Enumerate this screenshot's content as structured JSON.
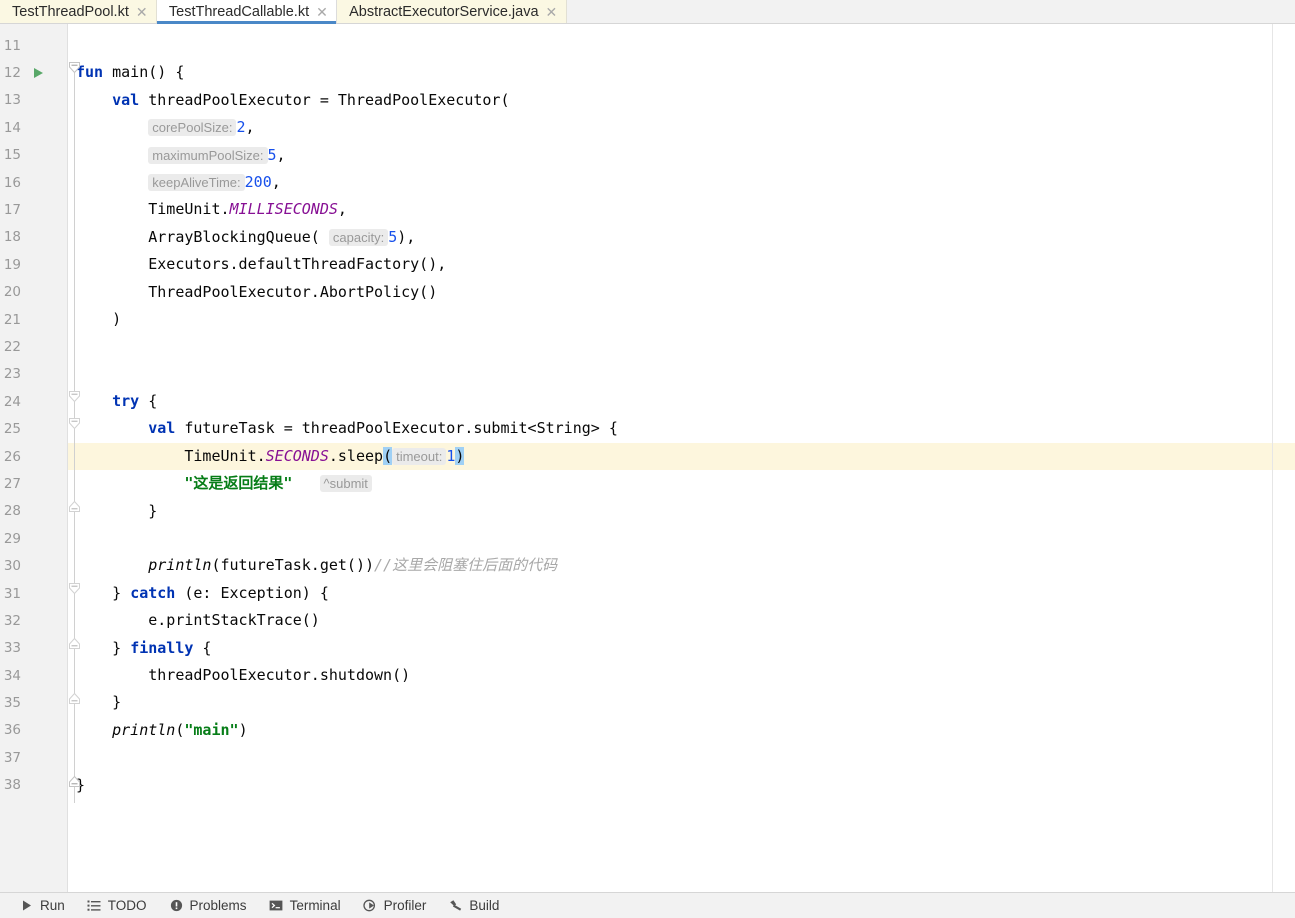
{
  "window": {
    "app": "IntelliJ IDEA",
    "theme_accent": "#4a88c7"
  },
  "tabs": [
    {
      "label": "TestThreadPool.kt",
      "close": "✕",
      "active": false,
      "modified": true
    },
    {
      "label": "TestThreadCallable.kt",
      "close": "✕",
      "active": true,
      "modified": false
    },
    {
      "label": "AbstractExecutorService.java",
      "close": "✕",
      "active": false,
      "modified": true
    }
  ],
  "editor": {
    "file": "TestThreadCallable.kt",
    "language": "Kotlin",
    "first_visible_line": 11,
    "last_visible_line": 38,
    "caret_line": 26,
    "caret_line_color": "#fdf6dd",
    "bracket_match_color": "#9fd0f5",
    "run_marker_line": 12,
    "line_numbers": [
      11,
      12,
      13,
      14,
      15,
      16,
      17,
      18,
      19,
      20,
      21,
      22,
      23,
      24,
      25,
      26,
      27,
      28,
      29,
      30,
      31,
      32,
      33,
      34,
      35,
      36,
      37,
      38
    ],
    "lines": [
      {
        "n": 11,
        "text": ""
      },
      {
        "n": 12,
        "text": "fun main() {"
      },
      {
        "n": 13,
        "text": "    val threadPoolExecutor = ThreadPoolExecutor("
      },
      {
        "n": 14,
        "text": "        corePoolSize: 2,"
      },
      {
        "n": 15,
        "text": "        maximumPoolSize: 5,"
      },
      {
        "n": 16,
        "text": "        keepAliveTime: 200,"
      },
      {
        "n": 17,
        "text": "        TimeUnit.MILLISECONDS,"
      },
      {
        "n": 18,
        "text": "        ArrayBlockingQueue( capacity: 5),"
      },
      {
        "n": 19,
        "text": "        Executors.defaultThreadFactory(),"
      },
      {
        "n": 20,
        "text": "        ThreadPoolExecutor.AbortPolicy()"
      },
      {
        "n": 21,
        "text": "    )"
      },
      {
        "n": 22,
        "text": ""
      },
      {
        "n": 23,
        "text": ""
      },
      {
        "n": 24,
        "text": "    try {"
      },
      {
        "n": 25,
        "text": "        val futureTask = threadPoolExecutor.submit<String> {"
      },
      {
        "n": 26,
        "text": "            TimeUnit.SECONDS.sleep( timeout: 1)"
      },
      {
        "n": 27,
        "text": "            \"这是返回结果\"   ^submit"
      },
      {
        "n": 28,
        "text": "        }"
      },
      {
        "n": 29,
        "text": ""
      },
      {
        "n": 30,
        "text": "        println(futureTask.get())//这里会阻塞住后面的代码"
      },
      {
        "n": 31,
        "text": "    } catch (e: Exception) {"
      },
      {
        "n": 32,
        "text": "        e.printStackTrace()"
      },
      {
        "n": 33,
        "text": "    } finally {"
      },
      {
        "n": 34,
        "text": "        threadPoolExecutor.shutdown()"
      },
      {
        "n": 35,
        "text": "    }"
      },
      {
        "n": 36,
        "text": "    println(\"main\")"
      },
      {
        "n": 37,
        "text": ""
      },
      {
        "n": 38,
        "text": "}"
      }
    ],
    "inlay_hints": [
      {
        "line": 14,
        "label": "corePoolSize:",
        "value": "2"
      },
      {
        "line": 15,
        "label": "maximumPoolSize:",
        "value": "5"
      },
      {
        "line": 16,
        "label": "keepAliveTime:",
        "value": "200"
      },
      {
        "line": 18,
        "label": "capacity:",
        "value": "5"
      },
      {
        "line": 26,
        "label": "timeout:",
        "value": "1"
      },
      {
        "line": 27,
        "label": "^submit",
        "value": ""
      }
    ],
    "tokens": {
      "l12": {
        "kw": "fun",
        "name": "main",
        "tail": "() {"
      },
      "l13": {
        "kw": "val",
        "name": "threadPoolExecutor",
        "eq": "=",
        "call": "ThreadPoolExecutor("
      },
      "l17": {
        "owner": "TimeUnit.",
        "constant": "MILLISECONDS",
        "tail": ","
      },
      "l18": {
        "call": "ArrayBlockingQueue(",
        "hint": "capacity:",
        "num": "5",
        "tail": "),"
      },
      "l19": {
        "text": "Executors.defaultThreadFactory(),"
      },
      "l20": {
        "text": "ThreadPoolExecutor.AbortPolicy()"
      },
      "l24": {
        "kw": "try",
        "tail": " {"
      },
      "l25": {
        "kw": "val",
        "name": "futureTask",
        "eq": "=",
        "call": "threadPoolExecutor.submit<String> {"
      },
      "l26": {
        "owner": "TimeUnit.",
        "constant": "SECONDS",
        "method": ".sleep",
        "open": "(",
        "hint": "timeout:",
        "num": "1",
        "close": ")"
      },
      "l27": {
        "string": "\"这是返回结果\"",
        "hint": "^submit"
      },
      "l30": {
        "fn": "println",
        "args": "(futureTask.get())",
        "comment": "//这里会阻塞住后面的代码"
      },
      "l31": {
        "pre": "} ",
        "kw": "catch",
        "tail": " (e: Exception) {"
      },
      "l32": {
        "text": "e.printStackTrace()"
      },
      "l33": {
        "pre": "} ",
        "kw": "finally",
        "tail": " {"
      },
      "l34": {
        "text": "threadPoolExecutor.shutdown()"
      },
      "l35": {
        "text": "}"
      },
      "l36": {
        "fn": "println",
        "open": "(",
        "string": "\"main\"",
        "close": ")"
      },
      "l38": {
        "text": "}"
      }
    },
    "colors": {
      "keyword": "#0033b3",
      "number": "#1750eb",
      "string": "#067d17",
      "comment": "#a8a8a8",
      "static_constant": "#871094",
      "plain": "#080808",
      "inlay_hint": "#999999",
      "gutter_bg": "#f2f2f2",
      "line_number": "#999999",
      "run_marker": "#59a869"
    }
  },
  "statusbar": {
    "items": [
      {
        "label": "Run",
        "icon": "run-icon"
      },
      {
        "label": "TODO",
        "icon": "todo-icon"
      },
      {
        "label": "Problems",
        "icon": "problems-icon"
      },
      {
        "label": "Terminal",
        "icon": "terminal-icon"
      },
      {
        "label": "Profiler",
        "icon": "profiler-icon"
      },
      {
        "label": "Build",
        "icon": "build-icon"
      }
    ]
  }
}
